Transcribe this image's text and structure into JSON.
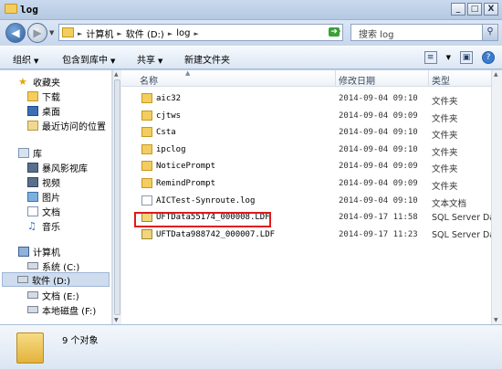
{
  "window": {
    "title": "log",
    "min": "_",
    "max": "□",
    "close": "X"
  },
  "address": {
    "crumbs": [
      "计算机",
      "软件 (D:)",
      "log"
    ],
    "search_placeholder": "搜索 log"
  },
  "toolbar": {
    "organize": "组织",
    "include_library": "包含到库中",
    "share": "共享",
    "new_folder": "新建文件夹"
  },
  "navigation": {
    "favorites": "收藏夹",
    "downloads": "下载",
    "desktop": "桌面",
    "recent": "最近访问的位置",
    "libraries": "库",
    "storm": "暴风影视库",
    "videos": "视频",
    "pictures": "图片",
    "documents": "文档",
    "music": "音乐",
    "computer": "计算机",
    "drive_c": "系统 (C:)",
    "drive_d": "软件 (D:)",
    "drive_e": "文档 (E:)",
    "drive_f": "本地磁盘 (F:)"
  },
  "columns": {
    "name": "名称",
    "modified": "修改日期",
    "type": "类型"
  },
  "files": [
    {
      "name": "aic32",
      "date": "2014-09-04 09:10",
      "type": "文件夹",
      "icon": "folder"
    },
    {
      "name": "cjtws",
      "date": "2014-09-04 09:09",
      "type": "文件夹",
      "icon": "folder"
    },
    {
      "name": "Csta",
      "date": "2014-09-04 09:10",
      "type": "文件夹",
      "icon": "folder"
    },
    {
      "name": "ipclog",
      "date": "2014-09-04 09:10",
      "type": "文件夹",
      "icon": "folder"
    },
    {
      "name": "NoticePrompt",
      "date": "2014-09-04 09:09",
      "type": "文件夹",
      "icon": "folder"
    },
    {
      "name": "RemindPrompt",
      "date": "2014-09-04 09:09",
      "type": "文件夹",
      "icon": "folder"
    },
    {
      "name": "AICTest-Synroute.log",
      "date": "2014-09-04 09:10",
      "type": "文本文档",
      "icon": "log"
    },
    {
      "name": "UFTData55174_000008.LDF",
      "date": "2014-09-17 11:58",
      "type": "SQL Server Dat",
      "icon": "ldf"
    },
    {
      "name": "UFTData988742_000007.LDF",
      "date": "2014-09-17 11:23",
      "type": "SQL Server Dat",
      "icon": "ldf"
    }
  ],
  "details": {
    "count": "9 个对象"
  },
  "colors": {
    "highlight": "#e0191c",
    "selection": "#cfdcee"
  }
}
